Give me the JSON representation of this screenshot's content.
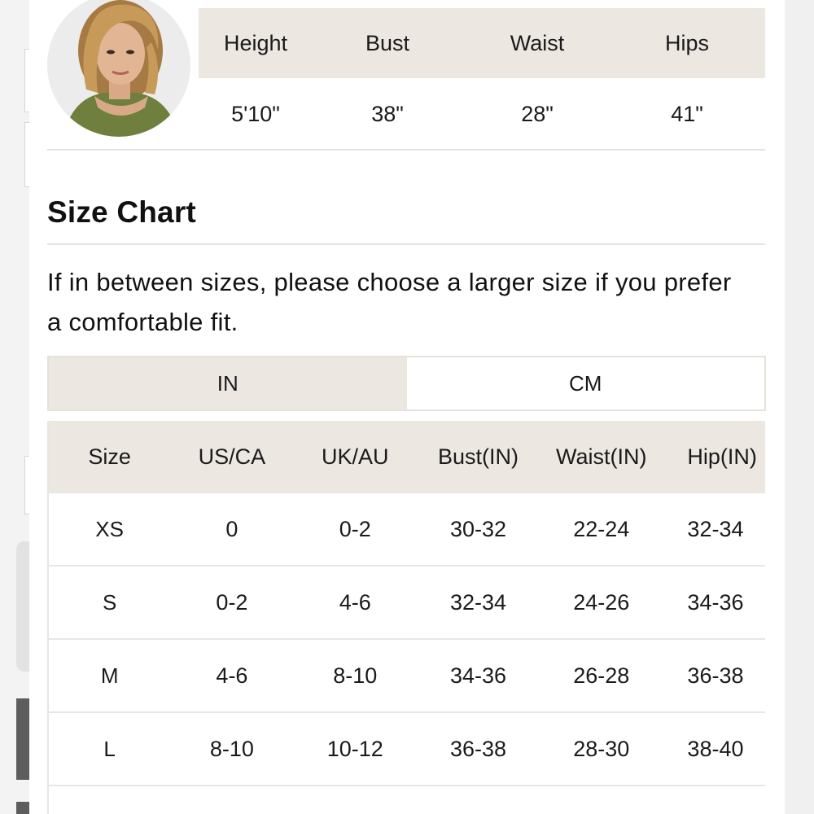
{
  "model": {
    "headers": [
      "Height",
      "Bust",
      "Waist",
      "Hips"
    ],
    "values": [
      "5'10\"",
      "38\"",
      "28\"",
      "41\""
    ]
  },
  "size_chart": {
    "title": "Size Chart",
    "note": "If in between sizes, please choose a larger size if you prefer a comfortable fit.",
    "units": {
      "in_label": "IN",
      "cm_label": "CM",
      "selected": "IN"
    },
    "columns": [
      "Size",
      "US/CA",
      "UK/AU",
      "Bust(IN)",
      "Waist(IN)",
      "Hip(IN)"
    ],
    "rows": [
      [
        "XS",
        "0",
        "0-2",
        "30-32",
        "22-24",
        "32-34"
      ],
      [
        "S",
        "0-2",
        "4-6",
        "32-34",
        "24-26",
        "34-36"
      ],
      [
        "M",
        "4-6",
        "8-10",
        "34-36",
        "26-28",
        "36-38"
      ],
      [
        "L",
        "8-10",
        "10-12",
        "36-38",
        "28-30",
        "38-40"
      ]
    ]
  },
  "colors": {
    "header_bg": "#ece7e1",
    "divider": "#e3e3e3",
    "text": "#111111"
  }
}
